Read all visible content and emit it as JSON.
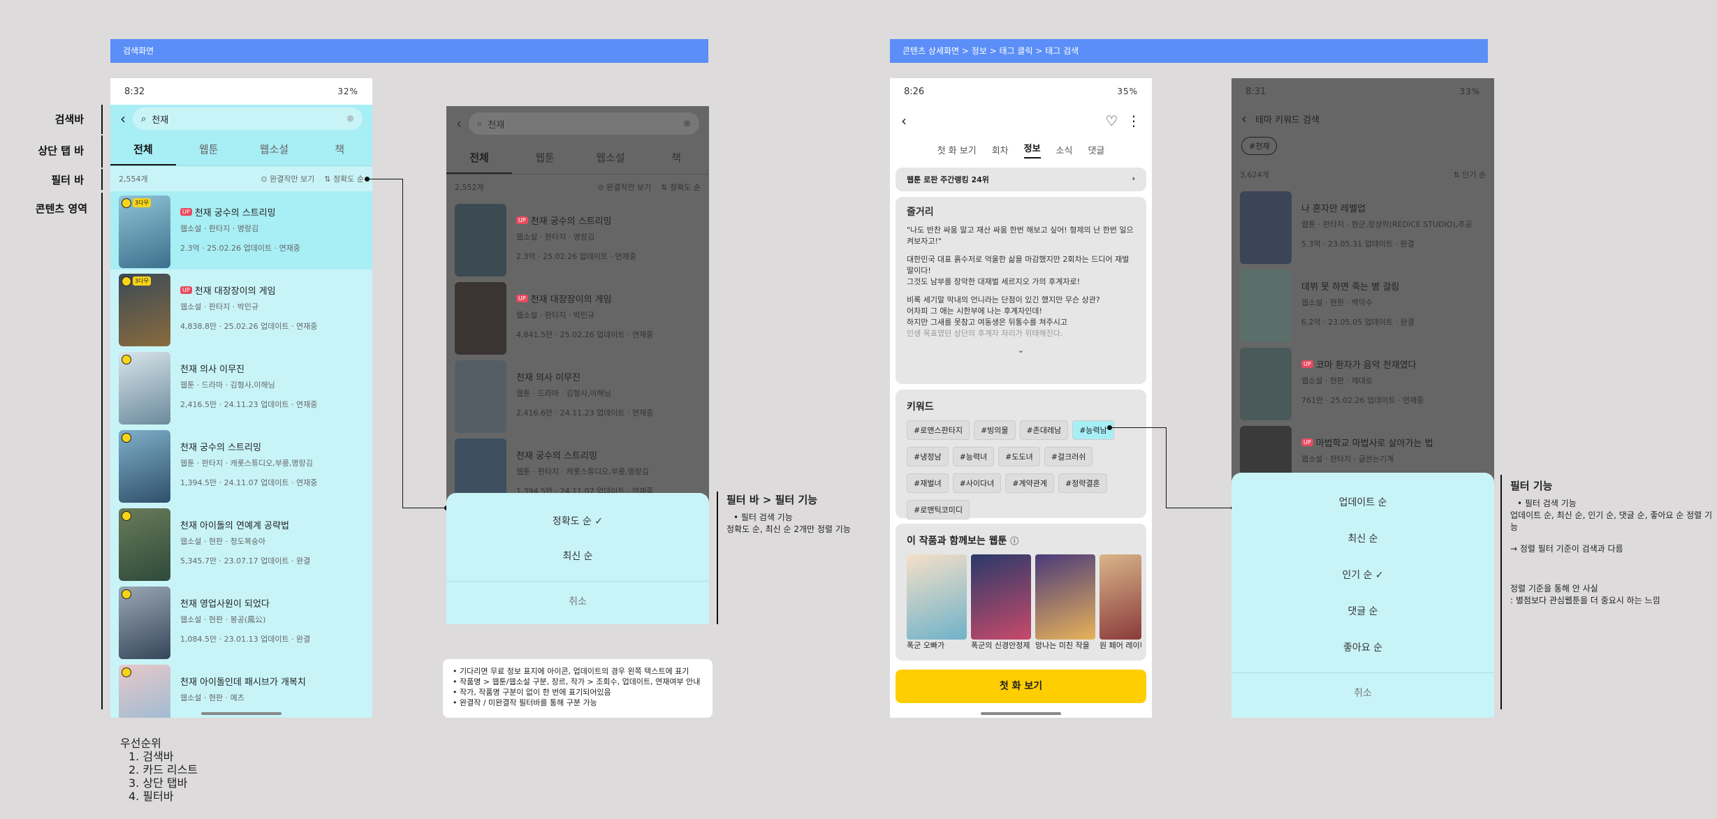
{
  "banners": {
    "left": "검색화면",
    "right": "콘텐츠 상세화면 > 정보 > 태그 클릭 > 태그 검색"
  },
  "labels": {
    "search": "검색바",
    "tabs": "상단 탭 바",
    "filter": "필터 바",
    "content": "콘텐츠 영역"
  },
  "phone1": {
    "time": "8:32",
    "battery": "32%",
    "search_value": "천재",
    "tabs": [
      "전체",
      "웹툰",
      "웹소설",
      "책"
    ],
    "count": "2,554개",
    "complete": "완결작만 보기",
    "sort": "정확도 순",
    "cards": [
      {
        "title": "천재 궁수의 스트리밍",
        "up": "UP",
        "sub": "웹소설 · 판타지 · 명랑김",
        "stat": "2.3억 · 25.02.26 업데이트 · 연재중"
      },
      {
        "title": "천재 대장장이의 게임",
        "up": "UP",
        "sub": "웹소설 · 판타지 · 박민규",
        "stat": "4,838.8만 · 25.02.26 업데이트 · 연재중"
      },
      {
        "title": "천재 의사 이무진",
        "up": "",
        "sub": "웹툰 · 드라마 · 김형사,이해님",
        "stat": "2,416.5만 · 24.11.23 업데이트 · 연재중"
      },
      {
        "title": "천재 궁수의 스트리밍",
        "up": "",
        "sub": "웹툰 · 판타지 · 캐롯스튜디오,부릉,명랑김",
        "stat": "1,394.5만 · 24.11.07 업데이트 · 연재중"
      },
      {
        "title": "천재 아이돌의 연예계 공략법",
        "up": "",
        "sub": "웹소설 · 현판 · 청도복숭아",
        "stat": "5,345.7만 · 23.07.17 업데이트 · 완결"
      },
      {
        "title": "천재 영업사원이 되었다",
        "up": "",
        "sub": "웹소설 · 현판 · 봉공(鳳公)",
        "stat": "1,084.5만 · 23.01.13 업데이트 · 완결"
      },
      {
        "title": "천재 아이돌인데 패시브가 개복치",
        "up": "",
        "sub": "웹소설 · 현판 · 예츠",
        "stat": ""
      }
    ]
  },
  "phone2": {
    "search_value": "천재",
    "tabs": [
      "전체",
      "웹툰",
      "웹소설",
      "책"
    ],
    "count": "2,552개",
    "complete": "완결작만 보기",
    "sort": "정확도 순",
    "cards": [
      {
        "title": "천재 궁수의 스트리밍",
        "up": "UP",
        "sub": "웹소설 · 판타지 · 명랑김",
        "stat": "2.3억 · 25.02.26 업데이트 · 연재중"
      },
      {
        "title": "천재 대장장이의 게임",
        "up": "UP",
        "sub": "웹소설 · 판타지 · 박민규",
        "stat": "4,841.5만 · 25.02.26 업데이트 · 연재중"
      },
      {
        "title": "천재 의사 이무진",
        "up": "",
        "sub": "웹툰 · 드라마 · 김형사,이해님",
        "stat": "2,416.6만 · 24.11.23 업데이트 · 연재중"
      },
      {
        "title": "천재 궁수의 스트리밍",
        "up": "",
        "sub": "웹툰 · 판타지 · 캐롯스튜디오,부릉,명랑김",
        "stat": "1,394.5만 · 24.11.07 업데이트 · 연재중"
      }
    ],
    "sheet": {
      "opt1": "정확도 순",
      "opt2": "최신 순",
      "cancel": "취소"
    }
  },
  "note1": {
    "title": "필터 바 > 필터 기능",
    "line1": "• 필터 검색 기능",
    "line2": "정확도 순, 최신 순 2개만 정렬 기능"
  },
  "note2": {
    "lines": [
      "• 기다리면 무료 정보 표지에 아이콘, 업데이트의 경우 왼쪽 텍스트에 표기",
      "• 작품명 > 웹툰/웹소설 구분, 장르, 작가 > 조회수, 업데이트, 연재여부 안내",
      "• 작가, 작품명 구분이 없이 한 번에 표기되어있음",
      "• 완결작 / 미완결작 필터바를 통해 구분 가능"
    ]
  },
  "priority": {
    "title": "우선순위",
    "items": [
      "1. 검색바",
      "2. 카드 리스트",
      "3. 상단 탭바",
      "4. 필터바"
    ]
  },
  "phone3": {
    "time": "8:26",
    "battery": "35%",
    "tabs": [
      "첫 화 보기",
      "회차",
      "정보",
      "소식",
      "댓글"
    ],
    "rank": "웹툰 로판 주간랭킹 24위",
    "synopsis_title": "줄거리",
    "synopsis": [
      "\"나도 반찬 싸움 말고 재산 싸움 한번 해보고 싶어! 형제의 난 한번 일으켜보자고!\"",
      "대한민국 대표 흙수저로 억울한 삶을 마감했지만 2회차는 드디어 재벌 딸이다!",
      "그것도 남부를 장악한 대재벌 세르지오 가의 후계자로!",
      "비록 세기말 막내의 언니라는 단점이 있긴 했지만 무슨 상관?",
      "어차피 그 애는 시한부에 나는 후계자인데!",
      "하지만 그새를 못참고 여동생은 뒤통수를 쳐주시고",
      "인생 목표였던 상단의 후계자 자리가 위태해진다."
    ],
    "keyword_title": "키워드",
    "keywords": [
      "#로맨스판타지",
      "#빙의물",
      "#존대레남",
      "#능력남",
      "#냉정남",
      "#능력녀",
      "#도도녀",
      "#걸크러쉬",
      "#재벌녀",
      "#사이다녀",
      "#계약관계",
      "#정략결혼",
      "#로맨틱코미디"
    ],
    "rec_title": "이 작품과 함께보는 웹툰",
    "recs": [
      "폭군 오빠가",
      "폭군의 신경안정제",
      "망나는 미친 작을",
      "원 페어 레이디"
    ],
    "cta": "첫 화 보기"
  },
  "phone4": {
    "time": "8:31",
    "battery": "33%",
    "title": "테마 키워드 검색",
    "chip": "#천재",
    "count": "3,624개",
    "sort": "인기 순",
    "cards": [
      {
        "title": "나 혼자만 레벨업",
        "up": "",
        "sub": "웹툰 · 판타지 · 현군,장성락(REDICE STUDIO),추공",
        "stat": "5.3억 · 23.05.31 업데이트 · 완결"
      },
      {
        "title": "데뷔 못 하면 죽는 병 걸림",
        "up": "",
        "sub": "웹소설 · 현판 · 백덕수",
        "stat": "6.2억 · 23.05.05 업데이트 · 완결"
      },
      {
        "title": "코마 환자가 음악 천재였다",
        "up": "UP",
        "sub": "웹소설 · 현판 · 제대로",
        "stat": "761만 · 25.02.26 업데이트 · 연재중"
      },
      {
        "title": "마법학교 마법사로 살아가는 법",
        "up": "UP",
        "sub": "웹소설 · 판타지 · 글쓴는기계",
        "stat": ""
      }
    ],
    "sheet": [
      "업데이트 순",
      "최신 순",
      "인기 순",
      "댓글 순",
      "좋아요 순",
      "취소"
    ]
  },
  "note3": {
    "title": "필터 기능",
    "l1": "• 필터 검색 기능",
    "l2": "업데이트 순, 최신 순, 인기 순, 댓글 순, 좋아요 순 정렬 기능",
    "l3": "→ 정렬 필터 기준이 검색과 다름",
    "l4": "정렬 기준을 통해 안 사실",
    "l5": ": 별점보다 관심웹툰을 더 중요시 하는 느낌"
  }
}
